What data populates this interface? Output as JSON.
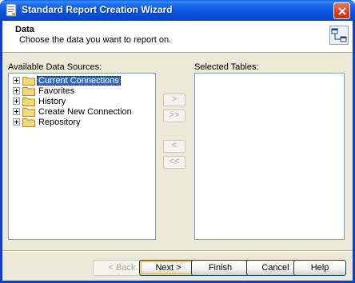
{
  "window": {
    "title": "Standard Report Creation Wizard"
  },
  "header": {
    "title": "Data",
    "subtitle": "Choose the data you want to report on."
  },
  "available": {
    "label": "Available Data Sources:",
    "items": [
      {
        "label": "Current Connections",
        "selected": true
      },
      {
        "label": "Favorites",
        "selected": false
      },
      {
        "label": "History",
        "selected": false
      },
      {
        "label": "Create New Connection",
        "selected": false
      },
      {
        "label": "Repository",
        "selected": false
      }
    ]
  },
  "selected": {
    "label": "Selected Tables:"
  },
  "transfer": {
    "add_one": ">",
    "add_all": ">>",
    "remove_one": "<",
    "remove_all": "<<"
  },
  "buttons": {
    "back": "< Back",
    "next": "Next >",
    "finish": "Finish",
    "cancel": "Cancel",
    "help": "Help"
  },
  "colors": {
    "titlebar": "#0a5ee8",
    "selection": "#316ac5",
    "dialog_bg": "#ece9d8"
  }
}
